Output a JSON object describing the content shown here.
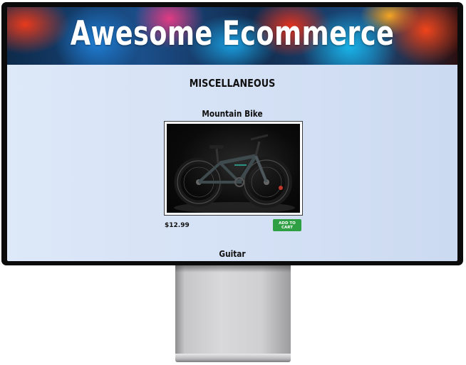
{
  "site": {
    "title": "Awesome Ecommerce"
  },
  "category": {
    "title": "MISCELLANEOUS"
  },
  "products": [
    {
      "name": "Mountain Bike",
      "price": "$12.99",
      "button_label": "ADD TO CART",
      "image": "mountain-bike-photo"
    },
    {
      "name": "Guitar"
    }
  ],
  "colors": {
    "button": "#2ea043",
    "page_background": "#d4e1f5",
    "bezel": "#0b0b0b"
  }
}
